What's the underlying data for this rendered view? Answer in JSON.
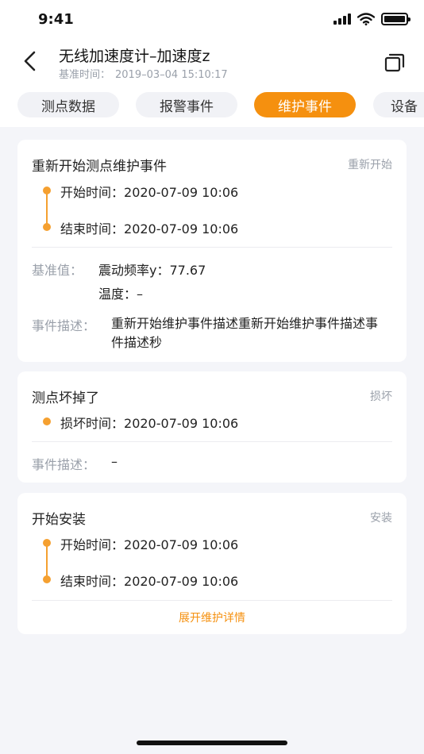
{
  "status_bar": {
    "time": "9:41"
  },
  "header": {
    "title": "无线加速度计–加速度z",
    "subtitle_label": "基准时间：",
    "subtitle_value": "2019–03–04 15:10:17"
  },
  "tabs": [
    {
      "label": "测点数据",
      "active": false
    },
    {
      "label": "报警事件",
      "active": false
    },
    {
      "label": "维护事件",
      "active": true
    },
    {
      "label": "设备",
      "active": false
    }
  ],
  "cards": [
    {
      "title": "重新开始测点维护事件",
      "tag": "重新开始",
      "start_label": "开始时间：",
      "start_value": "2020-07-09 10:06",
      "end_label": "结束时间：",
      "end_value": "2020-07-09 10:06",
      "baseline_label": "基准值：",
      "baseline_items": [
        {
          "name": "震动频率y：",
          "value": "77.67"
        },
        {
          "name": "温度：",
          "value": "–"
        }
      ],
      "desc_label": "事件描述：",
      "desc_value": "重新开始维护事件描述重新开始维护事件描述事件描述秒"
    },
    {
      "title": "测点坏掉了",
      "tag": "损坏",
      "damage_label": "损坏时间：",
      "damage_value": "2020-07-09 10:06",
      "desc_label": "事件描述：",
      "desc_value": "–"
    },
    {
      "title": "开始安装",
      "tag": "安装",
      "start_label": "开始时间：",
      "start_value": "2020-07-09 10:06",
      "end_label": "结束时间：",
      "end_value": "2020-07-09 10:06",
      "expand_label": "展开维护详情"
    }
  ],
  "icons": {
    "back": "chevron-left-icon",
    "windows": "multi-window-icon",
    "signal": "cellular-signal-icon",
    "wifi": "wifi-icon",
    "battery": "battery-icon"
  },
  "colors": {
    "accent": "#f5900f",
    "timeline": "#f5a030",
    "muted": "#9aa0aa",
    "background": "#f4f5f9"
  }
}
